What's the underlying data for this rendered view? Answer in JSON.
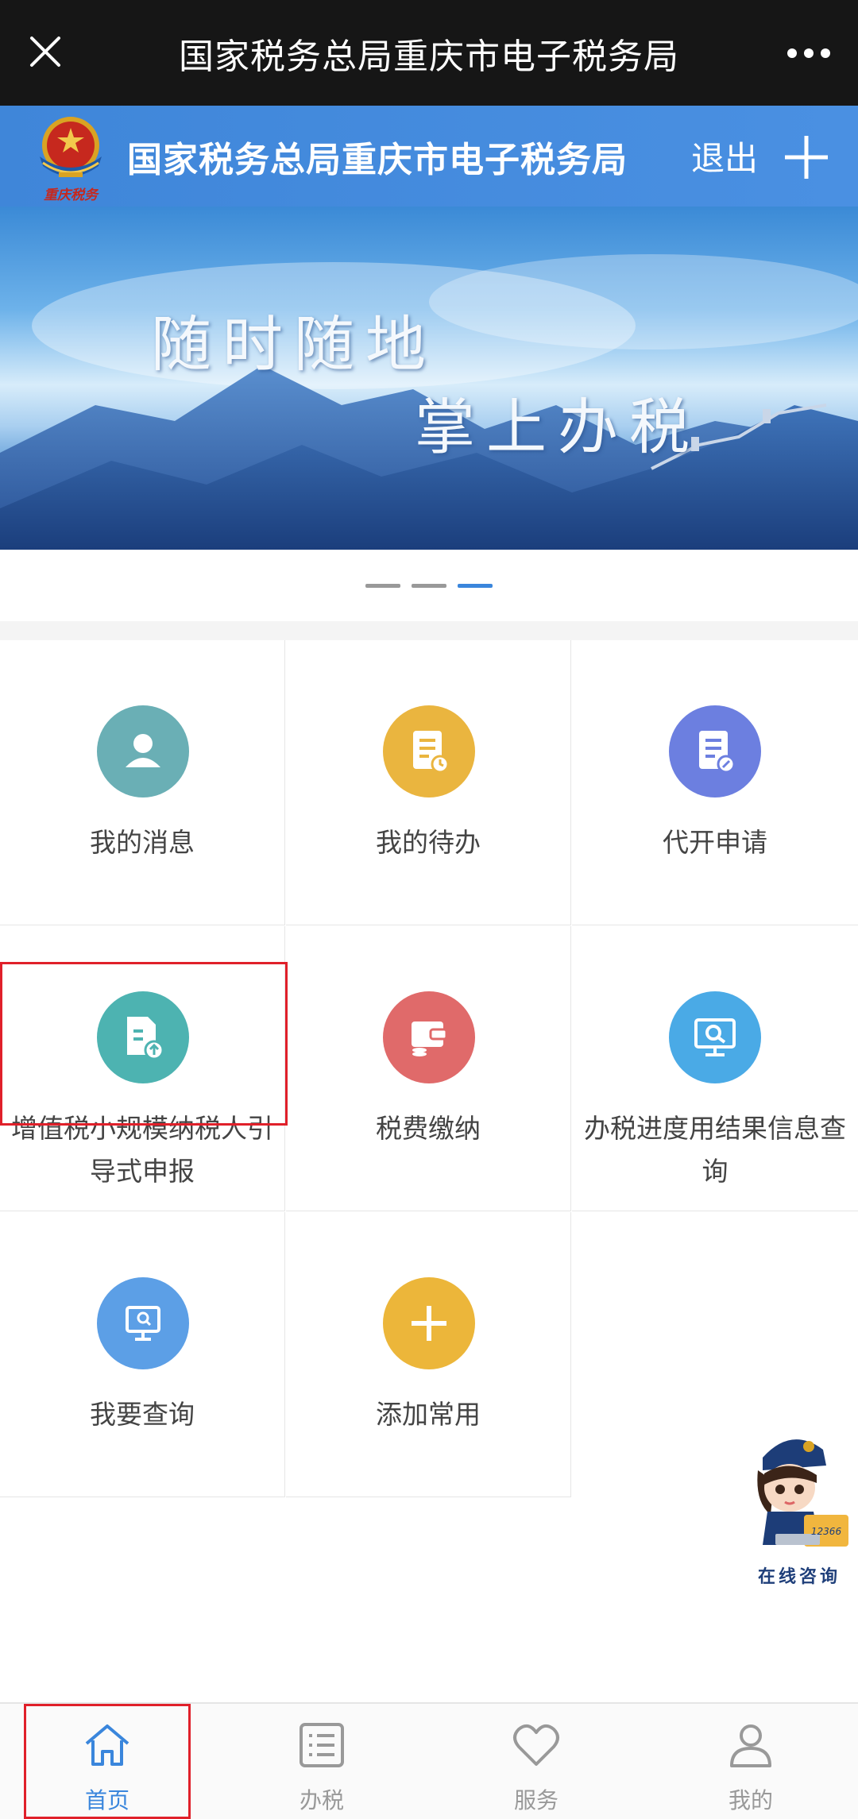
{
  "topbar": {
    "title": "国家税务总局重庆市电子税务局"
  },
  "header": {
    "site_title": "国家税务总局重庆市电子税务局",
    "logout_label": "退出",
    "emblem_caption": "重庆税务"
  },
  "banner": {
    "slogan_line1": "随时随地",
    "slogan_line2": "掌上办税",
    "slides": 3,
    "active_slide": 3
  },
  "grid": {
    "items": [
      {
        "label": "我的消息",
        "icon": "user-icon",
        "color": "#6aafb5"
      },
      {
        "label": "我的待办",
        "icon": "todo-document-icon",
        "color": "#eab53f"
      },
      {
        "label": "代开申请",
        "icon": "invoice-document-icon",
        "color": "#6c7fe0"
      },
      {
        "label": "增值税小规模纳税人引导式申报",
        "icon": "upload-document-icon",
        "color": "#4db3b1"
      },
      {
        "label": "税费缴纳",
        "icon": "wallet-icon",
        "color": "#e06a6a"
      },
      {
        "label": "办税进度用结果信息查询",
        "icon": "monitor-search-icon",
        "color": "#4aaae6"
      },
      {
        "label": "我要查询",
        "icon": "monitor-query-icon",
        "color": "#5c9fe6"
      },
      {
        "label": "添加常用",
        "icon": "plus-icon",
        "color": "#ecb63a"
      }
    ]
  },
  "assistant": {
    "label": "在线咨询",
    "badge": "12366"
  },
  "bottom_nav": {
    "items": [
      {
        "label": "首页",
        "icon": "home-icon",
        "active": true
      },
      {
        "label": "办税",
        "icon": "list-icon",
        "active": false
      },
      {
        "label": "服务",
        "icon": "heart-icon",
        "active": false
      },
      {
        "label": "我的",
        "icon": "person-icon",
        "active": false
      }
    ]
  },
  "colors": {
    "header_blue": "#4a90e2",
    "accent_blue": "#3a86dc",
    "highlight_red": "#e0202a"
  }
}
